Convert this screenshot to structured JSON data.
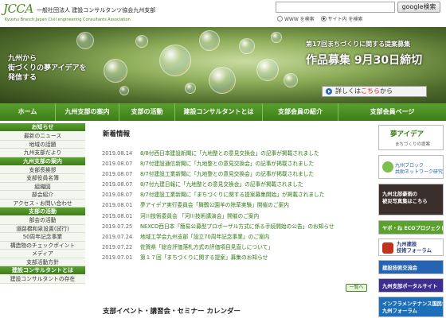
{
  "header": {
    "logo_mark": "JCCA",
    "logo_sub": "一般社団法人 建設コンサルタンツ協会九州支部",
    "logo_en": "Kyushu Branch,Japan Civil engineering Consultants Association",
    "search_placeholder": "",
    "search_button": "google検索",
    "radio_www": "WWW を検索",
    "radio_site": "サイト内 を検索"
  },
  "hero": {
    "left_line1": "九州から",
    "left_line2": "街づくりの夢アイデアを",
    "left_line3": "発信する",
    "title": "第17回まちづくりに関する提案募集",
    "deadline": "作品募集 9月30日締切",
    "detail_btn_prefix": "詳しくは",
    "detail_btn_accent": "こちら",
    "detail_btn_suffix": "から"
  },
  "nav": [
    "ホーム",
    "九州支部の案内",
    "支部の活動",
    "建設コンサルタントとは",
    "支部会員の紹介",
    "支部会員ページ"
  ],
  "sidebar": {
    "sections": [
      {
        "head": "お知らせ",
        "items": [
          "最新のニュース",
          "地域の話題",
          "九州支部だより"
        ]
      },
      {
        "head": "九州支部の案内",
        "items": [
          "支部長挨拶",
          "支部役員名簿",
          "組織図",
          "部会紹介",
          "アクセス・お問い合わせ"
        ]
      },
      {
        "head": "支部の活動",
        "items": [
          "部会の活動",
          "道路橋和泉設置(試行)",
          "50周年記念事業",
          "構造物のチェックポイント",
          "メディア",
          "支部活動方針"
        ]
      },
      {
        "head": "建設コンサルタントとは",
        "items": [
          "建設コンサルタントの存在"
        ]
      }
    ]
  },
  "main": {
    "news_title": "新着情報",
    "news": [
      {
        "date": "2019.08.14",
        "title": "8/8付西日本建設新聞に「九地整との意見交換会」の記事が掲載されました"
      },
      {
        "date": "2019.08.07",
        "title": "8/7付建設通信新聞に「九地整との意見交換会」の記事が掲載されました"
      },
      {
        "date": "2019.08.07",
        "title": "8/7付建設工業新聞に「九地整との意見交換会」の記事が掲載されました"
      },
      {
        "date": "2019.08.07",
        "title": "8/7付九建日報に「九地整との意見交換会」の記事が掲載されました"
      },
      {
        "date": "2019.08.07",
        "title": "8/7付建設工業新聞に「まちづくりに関する提案募集開始」が掲載されました"
      },
      {
        "date": "2019.08.01",
        "title": "夢アイデア実行委員会「舞鶴公園羊の除草実験」開催のご案内"
      },
      {
        "date": "2019.08.01",
        "title": "河川技術委員会 「河川技術講演会」開催のご案内"
      },
      {
        "date": "2019.07.25",
        "title": "NEXCO西日本「簡易公募型プロポーザル方式に係る手続開始の公告」のお知らせ"
      },
      {
        "date": "2019.07.24",
        "title": "地域工学会九州支部「設立70周年記念事業」のご案内"
      },
      {
        "date": "2019.07.22",
        "title": "佐賀県「総合評価落札方式の評価項目見直しについて」"
      },
      {
        "date": "2019.07.01",
        "title": "第１７回「まちづくりに関する提案」募集のお知らせ"
      }
    ],
    "more_label": "一覧へ",
    "events_title": "支部イベント・講習会・セミナー カレンダー"
  },
  "banners": {
    "b1_title": "夢アイデア",
    "b1_sub": "まちづくりの提案",
    "b2_line1": "九州ブロック",
    "b2_line2": "共助ネットワーク研究会",
    "b3_line1": "九州北部豪雨の",
    "b3_line2": "被災写真集はこちら",
    "b4": "ヤポ・ね ECOプロジェクト",
    "b5_line1": "九州建設",
    "b5_line2": "技術フォーラム",
    "b6": "建設技術交流会",
    "b7": "九州支部ポータルサイト",
    "b8_line1": "インフラメンテナンス国民会議",
    "b8_line2": "九州フォーラム"
  }
}
